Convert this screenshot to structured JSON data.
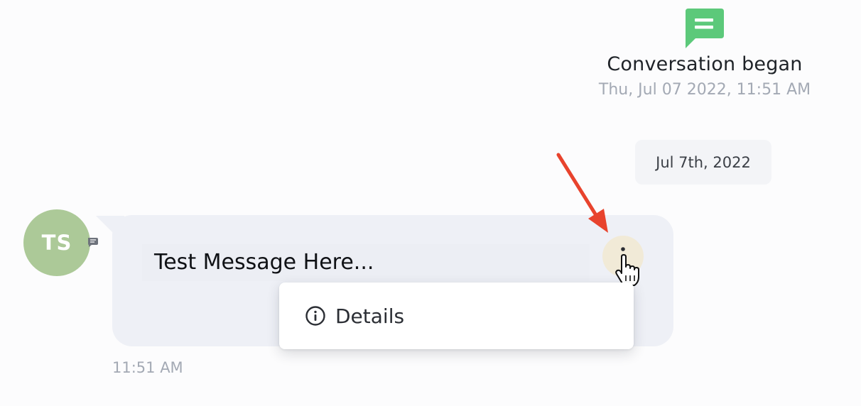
{
  "conversation_start": {
    "icon": "chat-bubble-icon",
    "title": "Conversation began",
    "date": "Thu, Jul 07 2022, 11:51 AM",
    "icon_color": "#5cc97a"
  },
  "date_divider": {
    "label": "Jul 7th, 2022"
  },
  "message": {
    "avatar_initials": "TS",
    "avatar_color": "#acc998",
    "channel_icon": "chat-channel-icon",
    "text": "Test Message Here...",
    "time": "11:51 AM",
    "more_options_icon": "vertical-dots-icon"
  },
  "context_menu": {
    "items": [
      {
        "icon": "info-icon",
        "label": "Details"
      }
    ]
  },
  "annotation": {
    "arrow_color": "#e8432d"
  }
}
